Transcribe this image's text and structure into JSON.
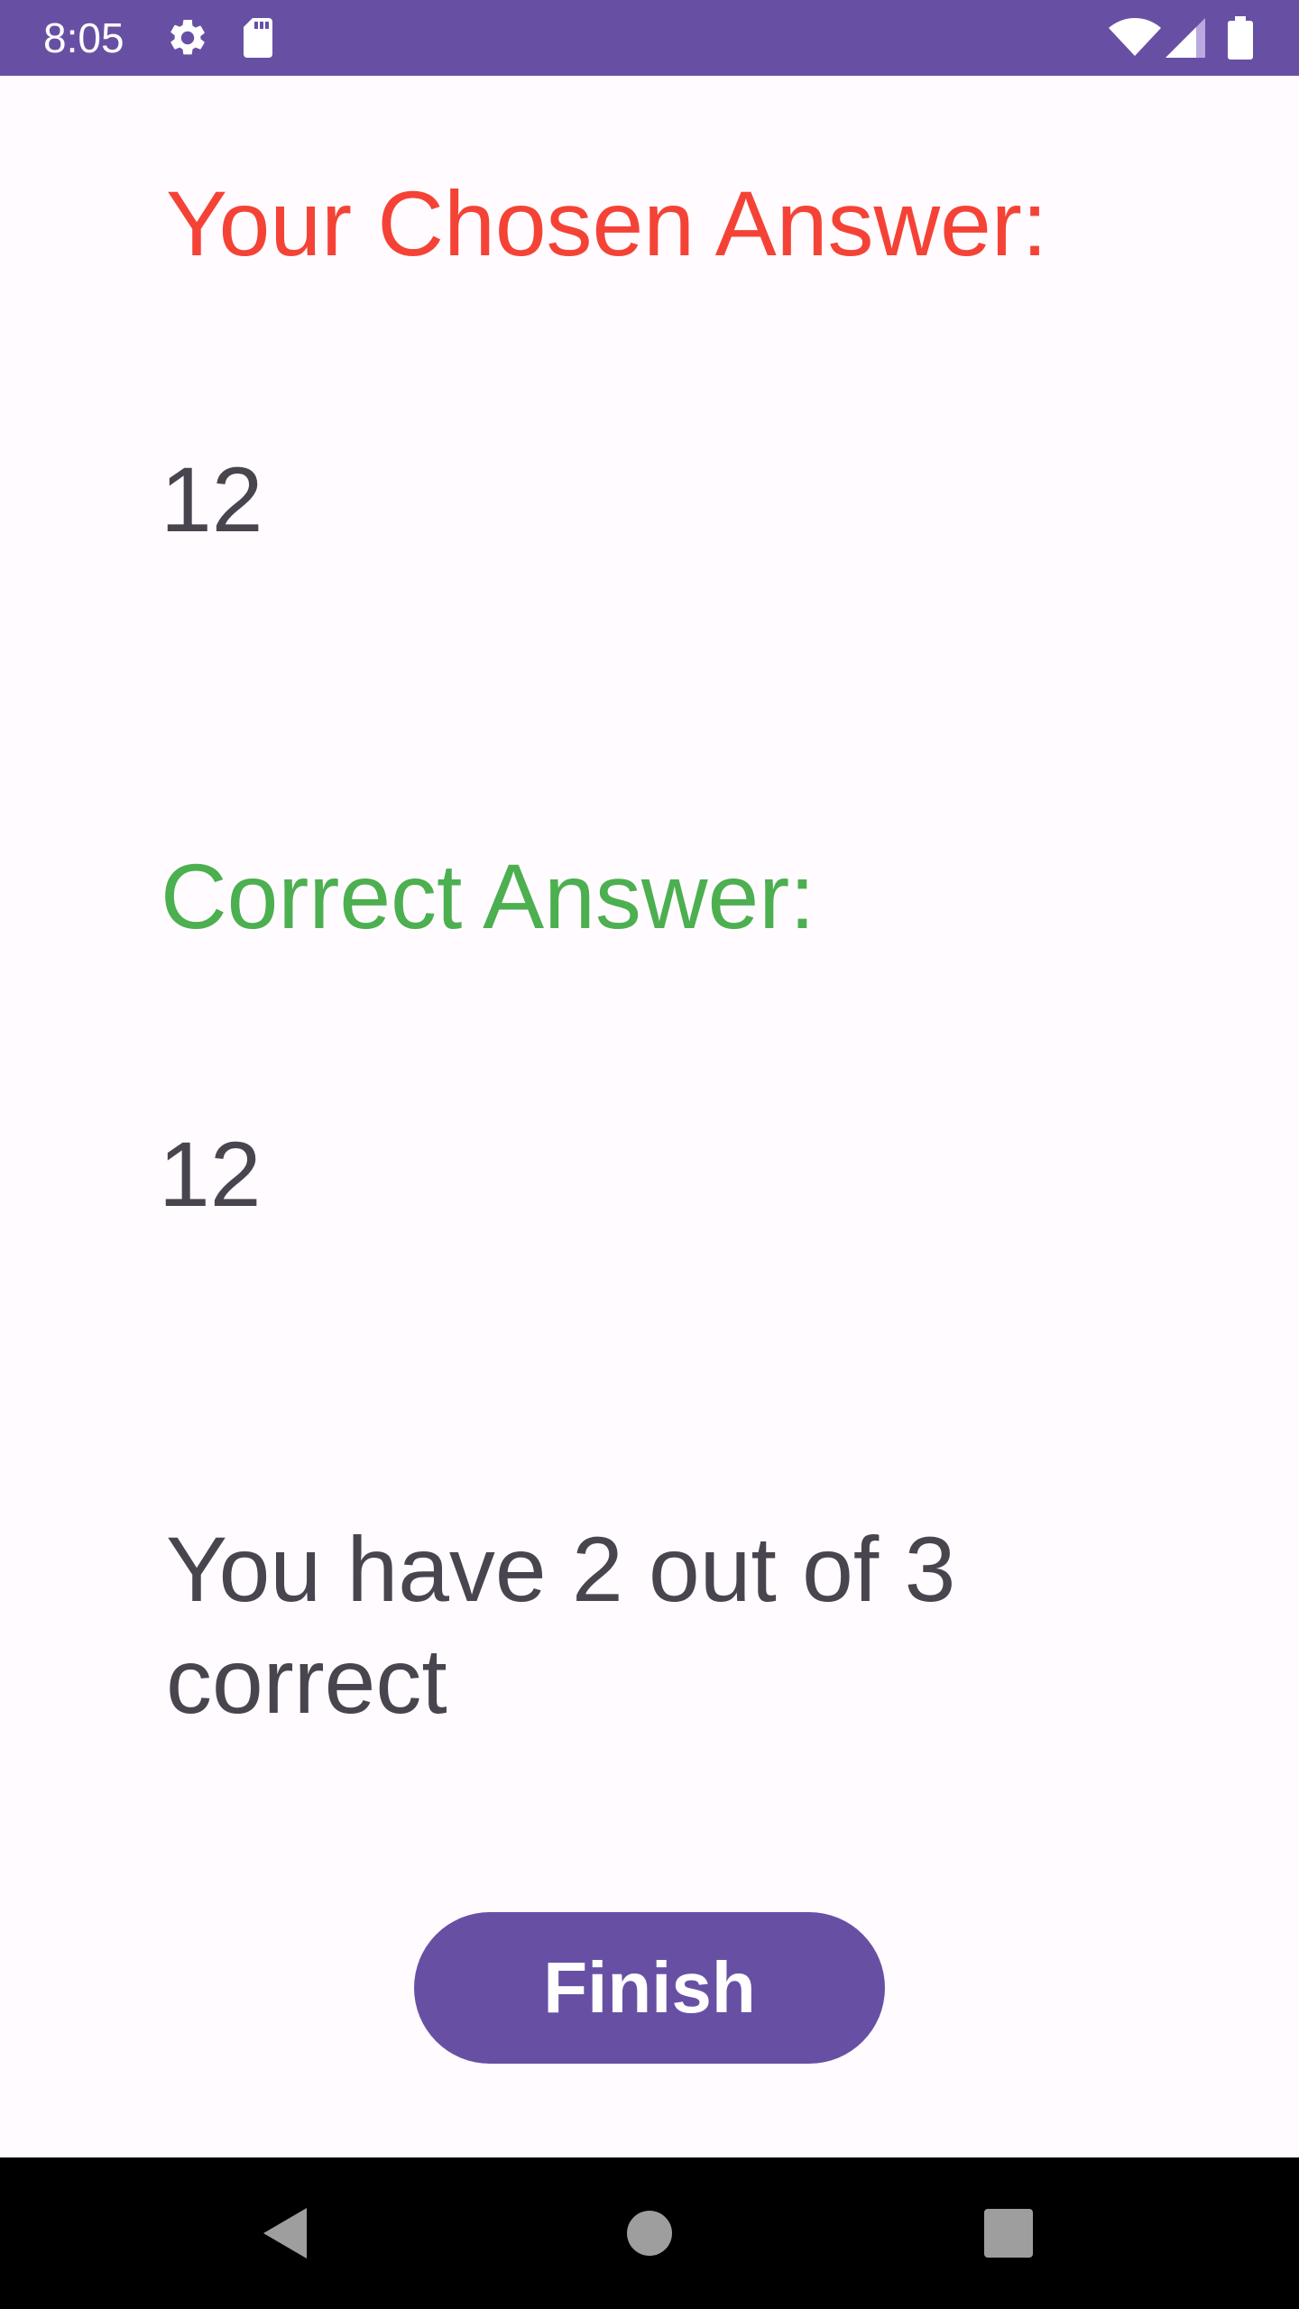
{
  "status_bar": {
    "time": "8:05",
    "icons": [
      "gear-icon",
      "sd-card-icon",
      "wifi-icon",
      "cell-signal-icon",
      "battery-icon"
    ],
    "background": "#6750A4"
  },
  "result": {
    "chosen_heading": "Your Chosen Answer:",
    "chosen_value": "12",
    "correct_heading": "Correct Answer:",
    "correct_value": "12",
    "score_text": "You have 2 out of 3 correct",
    "chosen_color": "#F44336",
    "correct_color": "#4CAF50"
  },
  "finish_button": {
    "label": "Finish",
    "color": "#6750A4"
  },
  "nav_bar": {
    "icons": [
      "back-icon",
      "home-icon",
      "recents-icon"
    ]
  }
}
